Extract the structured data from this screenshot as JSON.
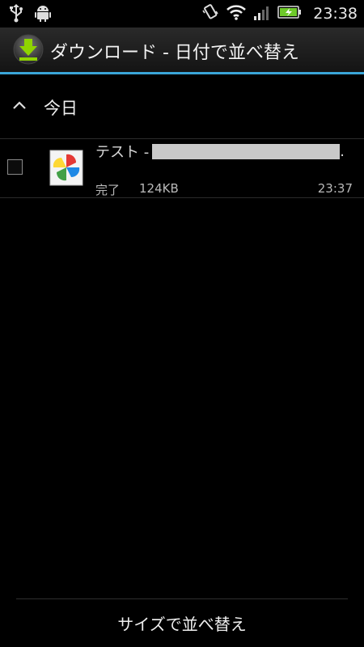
{
  "status_bar": {
    "time": "23:38",
    "icons": [
      "usb-icon",
      "android-debug-icon",
      "vibrate-icon",
      "wifi-icon",
      "signal-icon",
      "battery-charging-icon"
    ]
  },
  "title_bar": {
    "title": "ダウンロード - 日付で並べ替え",
    "icon": "download-icon",
    "accent_color": "#3aa6d8"
  },
  "group": {
    "label": "今日",
    "icon": "chevron-up-icon"
  },
  "downloads": [
    {
      "name_prefix": "テスト -",
      "name_suffix": ".",
      "status": "完了",
      "size": "124KB",
      "time": "23:37",
      "icon": "pinwheel-image-icon"
    }
  ],
  "footer": {
    "sort_button_label": "サイズで並べ替え"
  }
}
